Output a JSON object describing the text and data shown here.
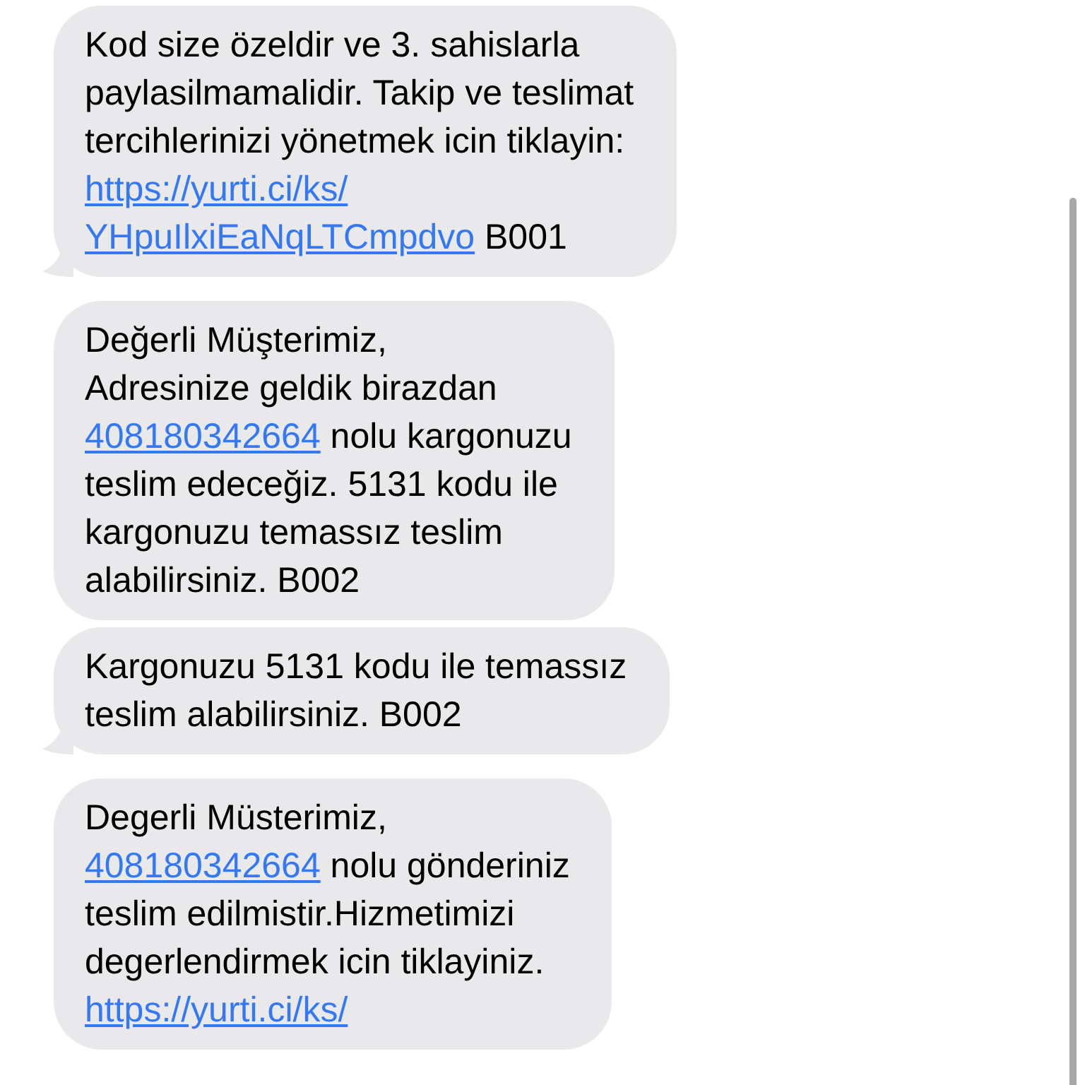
{
  "messages": [
    {
      "tail": true,
      "lines": [
        [
          {
            "kind": "text",
            "text": "Kod size özeldir ve 3. sahislarla"
          }
        ],
        [
          {
            "kind": "text",
            "text": "paylasilmamalidir. Takip ve teslimat"
          }
        ],
        [
          {
            "kind": "text",
            "text": "tercihlerinizi yönetmek icin tiklayin:"
          }
        ],
        [
          {
            "kind": "link",
            "text": "https://yurti.ci/ks/"
          }
        ],
        [
          {
            "kind": "link",
            "text": "YHpuIlxiEaNqLTCmpdvo"
          },
          {
            "kind": "text",
            "text": " B001"
          }
        ]
      ]
    },
    {
      "tail": false,
      "lines": [
        [
          {
            "kind": "text",
            "text": "Değerli Müşterimiz,"
          }
        ],
        [
          {
            "kind": "text",
            "text": "Adresinize geldik birazdan"
          }
        ],
        [
          {
            "kind": "link",
            "text": "408180342664"
          },
          {
            "kind": "text",
            "text": " nolu kargonuzu"
          }
        ],
        [
          {
            "kind": "text",
            "text": "teslim edeceğiz. 5131 kodu ile"
          }
        ],
        [
          {
            "kind": "text",
            "text": "kargonuzu temassız teslim"
          }
        ],
        [
          {
            "kind": "text",
            "text": "alabilirsiniz. B002"
          }
        ]
      ]
    },
    {
      "tail": true,
      "lines": [
        [
          {
            "kind": "text",
            "text": "Kargonuzu 5131 kodu ile temassız"
          }
        ],
        [
          {
            "kind": "text",
            "text": "teslim alabilirsiniz. B002"
          }
        ]
      ]
    },
    {
      "tail": false,
      "lines": [
        [
          {
            "kind": "text",
            "text": "Degerli Müsterimiz,"
          }
        ],
        [
          {
            "kind": "link",
            "text": "408180342664"
          },
          {
            "kind": "text",
            "text": " nolu gönderiniz"
          }
        ],
        [
          {
            "kind": "text",
            "text": "teslim edilmistir.Hizmetimizi"
          }
        ],
        [
          {
            "kind": "text",
            "text": "degerlendirmek icin tiklayiniz."
          }
        ],
        [
          {
            "kind": "link",
            "text": "https://yurti.ci/ks/"
          }
        ]
      ]
    }
  ]
}
